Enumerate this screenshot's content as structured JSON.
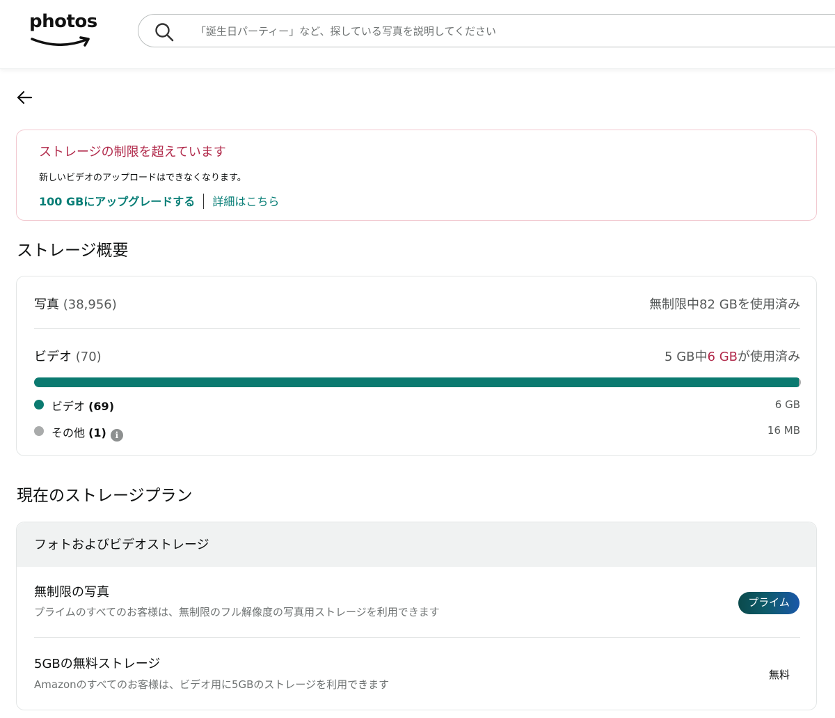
{
  "header": {
    "logo_text": "photos",
    "search_placeholder": "「誕生日パーティー」など、探している写真を説明してください"
  },
  "alert": {
    "title": "ストレージの制限を超えています",
    "body": "新しいビデオのアップロードはできなくなります。",
    "upgrade_link": "100 GBにアップグレードする",
    "details_link": "詳細はこちら"
  },
  "storage_overview": {
    "title": "ストレージ概要",
    "photos": {
      "label": "写真",
      "count": "(38,956)",
      "usage": "無制限中82 GBを使用済み"
    },
    "videos": {
      "label": "ビデオ",
      "count": "(70)",
      "usage_prefix": "5 GB中",
      "usage_amount": "6 GB",
      "usage_suffix": "が使用済み",
      "used_fraction": 0.997
    },
    "legend": [
      {
        "label": "ビデオ",
        "count": "(69)",
        "value": "6 GB",
        "color": "#0b7a70"
      },
      {
        "label": "その他",
        "count": "(1)",
        "value": "16 MB",
        "color": "#a9abab"
      }
    ]
  },
  "current_plan": {
    "title": "現在のストレージプラン",
    "section_header": "フォトおよびビデオストレージ",
    "plans": [
      {
        "name": "無制限の写真",
        "description": "プライムのすべてのお客様は、無制限のフル解像度の写真用ストレージを利用できます",
        "badge": "プライム"
      },
      {
        "name": "5GBの無料ストレージ",
        "description": "Amazonのすべてのお客様は、ビデオ用に5GBのストレージを利用できます",
        "tag": "無料"
      }
    ]
  },
  "colors": {
    "accent": "#067d75",
    "warning": "#b12a4b",
    "bar": "#0b7a70"
  }
}
